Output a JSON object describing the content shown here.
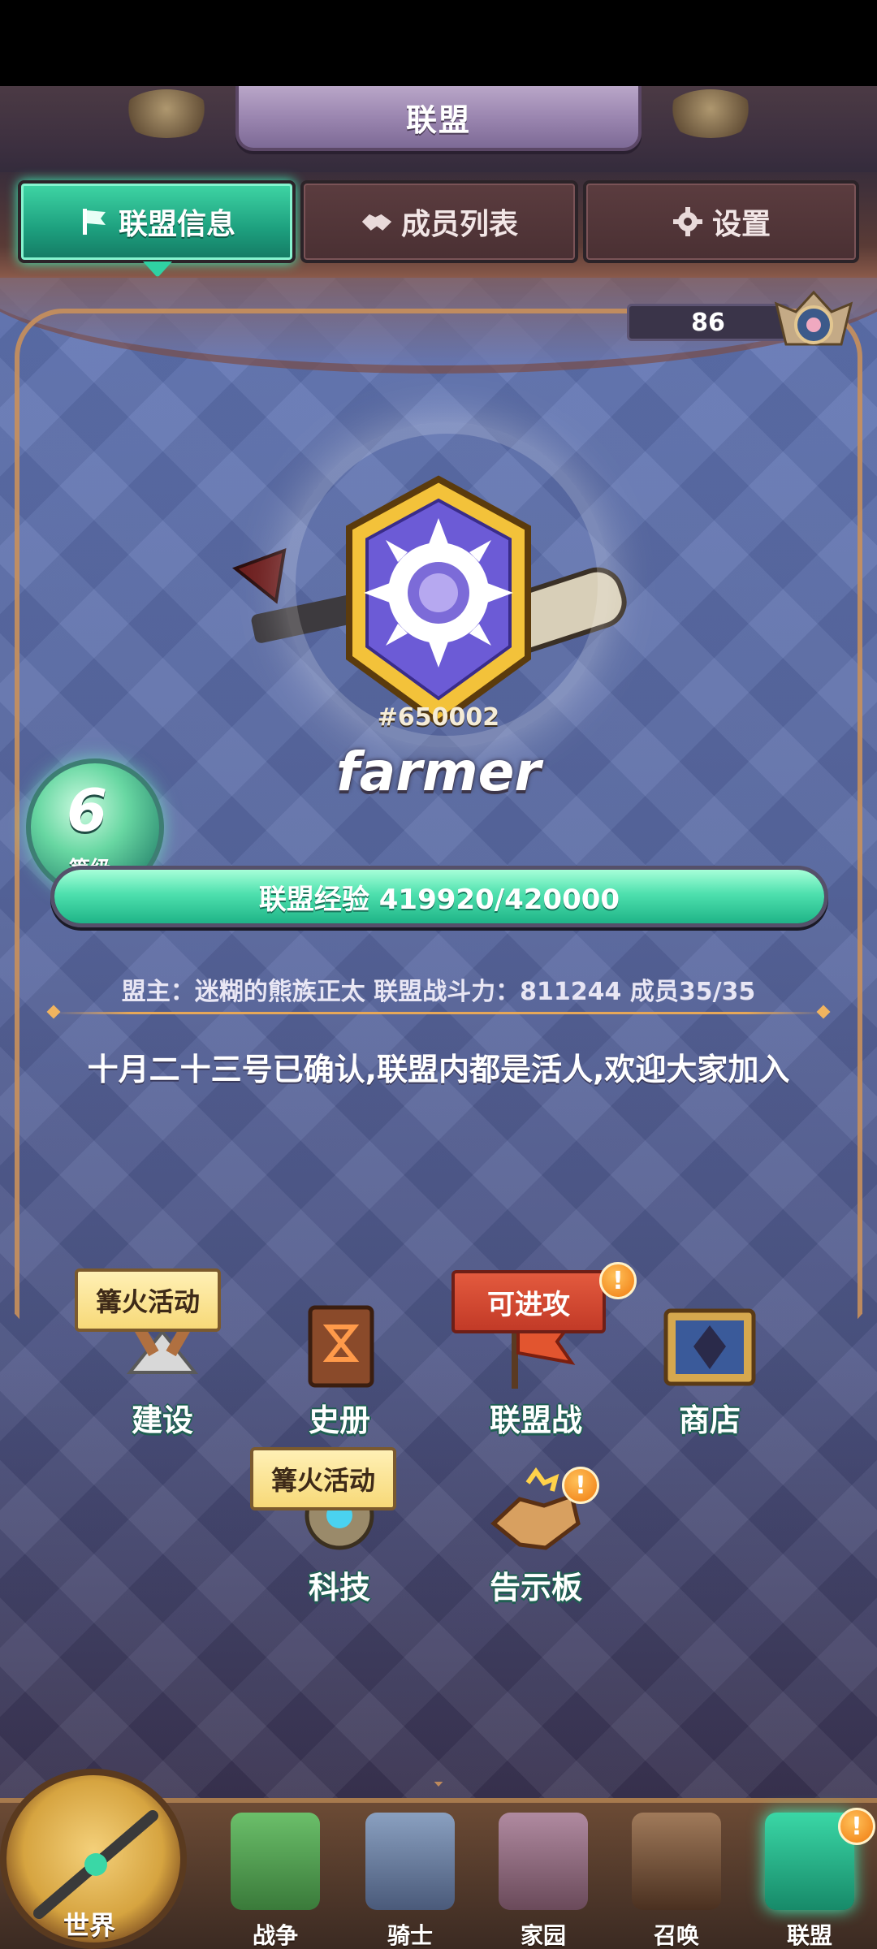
{
  "header": {
    "title": "联盟"
  },
  "tabs": [
    {
      "label": "联盟信息",
      "icon": "flag-icon",
      "active": true
    },
    {
      "label": "成员列表",
      "icon": "handshake-icon",
      "active": false
    },
    {
      "label": "设置",
      "icon": "gear-icon",
      "active": false
    }
  ],
  "season": {
    "value": "86"
  },
  "alliance": {
    "id": "#650002",
    "name": "farmer",
    "level": "6",
    "level_label": "等级",
    "exp_text": "联盟经验 419920/420000",
    "exp_fraction": 0.9998,
    "info": "盟主：迷糊的熊族正太  联盟战斗力：811244 成员35/35",
    "notice": "十月二十三号已确认,联盟内都是活人,欢迎大家加入"
  },
  "features": {
    "build": {
      "label": "建设",
      "tag": "篝火活动"
    },
    "history": {
      "label": "史册"
    },
    "war": {
      "label": "联盟战",
      "tag": "可进攻",
      "alert": "!"
    },
    "shop": {
      "label": "商店"
    },
    "tech": {
      "label": "科技",
      "tag": "篝火活动"
    },
    "board": {
      "label": "告示板",
      "alert": "!"
    }
  },
  "bottom_nav": {
    "world": "世界",
    "items": [
      {
        "label": "战争",
        "icon": "map-icon"
      },
      {
        "label": "骑士",
        "icon": "knight-icon"
      },
      {
        "label": "家园",
        "icon": "house-icon"
      },
      {
        "label": "召唤",
        "icon": "train-icon"
      },
      {
        "label": "联盟",
        "icon": "alliance-icon",
        "active": true,
        "alert": "!"
      }
    ]
  },
  "colors": {
    "accent": "#3fd6a5",
    "frame": "#c9905b",
    "panel": "#5a6aa4",
    "alert": "#f07a10"
  }
}
